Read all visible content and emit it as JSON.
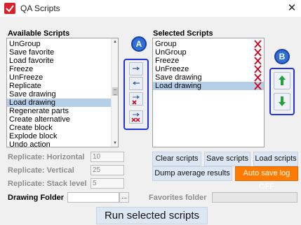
{
  "window": {
    "title": "QA Scripts",
    "close": "✕"
  },
  "available": {
    "label": "Available Scripts",
    "items": [
      "UnGroup",
      "Save favorite",
      "Load favorite",
      "Freeze",
      "UnFreeze",
      "Replicate",
      "Save drawing",
      "Load drawing",
      "Regenerate parts",
      "Create alternative",
      "Create block",
      "Explode block",
      "Undo action"
    ],
    "selected_index": 7
  },
  "selected": {
    "label": "Selected Scripts",
    "items": [
      "Group",
      "UnGroup",
      "Freeze",
      "UnFreeze",
      "Save drawing",
      "Load drawing"
    ],
    "selected_index": 5
  },
  "badges": {
    "a": "A",
    "b": "B"
  },
  "buttons": {
    "clear": "Clear scripts",
    "save": "Save scripts",
    "load": "Load scripts",
    "dump": "Dump average results",
    "autosave": "Auto save log OFF",
    "run": "Run selected scripts"
  },
  "replicate": {
    "horizontal_label": "Replicate: Horizontal",
    "horizontal_value": "10",
    "vertical_label": "Replicate: Vertical",
    "vertical_value": "25",
    "stack_label": "Replicate: Stack level",
    "stack_value": "5"
  },
  "folders": {
    "drawing_label": "Drawing Folder",
    "drawing_value": "",
    "browse": "...",
    "favorites_label": "Favorites folder",
    "favorites_value": ""
  },
  "colors": {
    "accent_blue": "#2233dd",
    "badge_blue": "#2f6fd6",
    "selection": "#b6cfe8",
    "orange": "#ff7b00",
    "remove_red": "#d0021b",
    "arrow_green": "#22a33a"
  },
  "icons": [
    "app-icon",
    "close-icon",
    "move-right-icon",
    "move-left-icon",
    "remove-one-icon",
    "remove-all-icon",
    "remove-item-icon",
    "move-up-icon",
    "move-down-icon"
  ]
}
